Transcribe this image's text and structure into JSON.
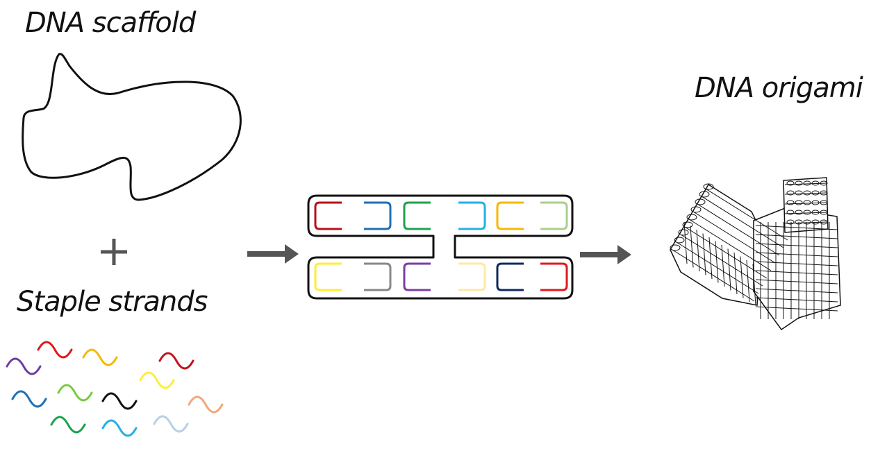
{
  "labels": {
    "scaffold": "DNA scaffold",
    "staples": "Staple strands",
    "origami": "DNA origami"
  },
  "colors": {
    "outline": "#111111",
    "arrow": "#555555",
    "plus": "#555555",
    "staples_top": [
      "#b5121b",
      "#1f6fb5",
      "#1aa34a",
      "#22b0e6",
      "#f5b800",
      "#a8d08d"
    ],
    "staples_bottom": [
      "#ffee33",
      "#888888",
      "#7a3fa0",
      "#ffe8a0",
      "#0d2a5e",
      "#e01a1a"
    ],
    "waves": [
      "#6f3da0",
      "#e01a1a",
      "#f5b800",
      "#c4121b",
      "#ffee33",
      "#1f6fb5",
      "#7ac943",
      "#111111",
      "#f2a77a",
      "#1aa34a",
      "#22b0e6",
      "#b8cfe8"
    ]
  },
  "icons": {
    "plus": "plus-sign",
    "arrows": [
      "right-arrow",
      "right-arrow"
    ]
  }
}
